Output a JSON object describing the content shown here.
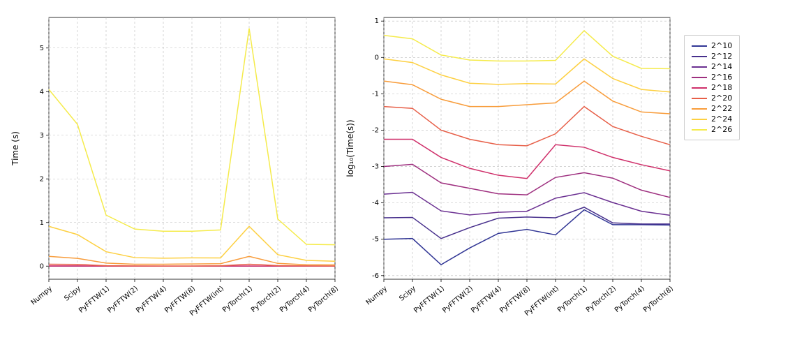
{
  "chart_data": [
    {
      "type": "line",
      "title": "",
      "xlabel": "",
      "ylabel": "Time (s)",
      "ylim": [
        -0.3,
        5.7
      ],
      "yticks": [
        0,
        1,
        2,
        3,
        4,
        5
      ],
      "categories": [
        "Numpy",
        "Scipy",
        "PyFFTW(1)",
        "PyFFTW(2)",
        "PyFFTW(4)",
        "PyFFTW(8)",
        "PyFFTW(int)",
        "PyTorch(1)",
        "PyTorch(2)",
        "PyTorch(4)",
        "PyTorch(8)"
      ],
      "series": [
        {
          "name": "2^10",
          "color": "#313695",
          "values": [
            1e-05,
            1.05e-05,
            2e-06,
            5.75e-06,
            1.46e-05,
            1.88e-05,
            1.31e-05,
            6.46e-05,
            2.51e-05,
            2.51e-05,
            2.46e-05
          ]
        },
        {
          "name": "2^12",
          "color": "#472f8c",
          "values": [
            3.89e-05,
            3.98e-05,
            1.05e-05,
            2.09e-05,
            3.8e-05,
            4.07e-05,
            3.89e-05,
            7.59e-05,
            2.82e-05,
            2.63e-05,
            2.63e-05
          ]
        },
        {
          "name": "2^14",
          "color": "#6a2f91",
          "values": [
            0.000174,
            0.000195,
            6.03e-05,
            4.68e-05,
            5.5e-05,
            5.89e-05,
            0.000135,
            0.000191,
            0.000102,
            5.89e-05,
            4.57e-05
          ]
        },
        {
          "name": "2^16",
          "color": "#9e2f7f",
          "values": [
            0.001,
            0.00115,
            0.000355,
            0.000251,
            0.000178,
            0.000166,
            0.000501,
            0.000676,
            0.000479,
            0.000224,
            0.000141
          ]
        },
        {
          "name": "2^18",
          "color": "#cf2f6a",
          "values": [
            0.00562,
            0.00562,
            0.00178,
            0.000891,
            0.000575,
            0.000468,
            0.00398,
            0.00339,
            0.00178,
            0.00112,
            0.000759
          ]
        },
        {
          "name": "2^20",
          "color": "#e75f48",
          "values": [
            0.0447,
            0.0398,
            0.01,
            0.00562,
            0.00398,
            0.00372,
            0.00794,
            0.0447,
            0.0126,
            0.00676,
            0.00398
          ]
        },
        {
          "name": "2^22",
          "color": "#f89c3a",
          "values": [
            0.224,
            0.178,
            0.0708,
            0.0447,
            0.0447,
            0.0501,
            0.0562,
            0.224,
            0.0631,
            0.0316,
            0.0282
          ]
        },
        {
          "name": "2^24",
          "color": "#fdd041",
          "values": [
            0.912,
            0.724,
            0.331,
            0.195,
            0.182,
            0.19,
            0.188,
            0.912,
            0.263,
            0.132,
            0.112
          ]
        },
        {
          "name": "2^26",
          "color": "#f5eb4b",
          "values": [
            4.05,
            3.25,
            1.17,
            0.85,
            0.8,
            0.8,
            0.83,
            5.45,
            1.08,
            0.5,
            0.49
          ]
        }
      ]
    },
    {
      "type": "line",
      "title": "",
      "xlabel": "",
      "ylabel": "log₁₀(Time(s))",
      "ylim": [
        -6.1,
        1.1
      ],
      "yticks": [
        -6,
        -5,
        -4,
        -3,
        -2,
        -1,
        0,
        1
      ],
      "categories": [
        "Numpy",
        "Scipy",
        "PyFFTW(1)",
        "PyFFTW(2)",
        "PyFFTW(4)",
        "PyFFTW(8)",
        "PyFFTW(int)",
        "PyTorch(1)",
        "PyTorch(2)",
        "PyTorch(4)",
        "PyTorch(8)"
      ],
      "series": [
        {
          "name": "2^10",
          "color": "#313695",
          "values": [
            -5.0,
            -4.98,
            -5.7,
            -5.24,
            -4.84,
            -4.73,
            -4.88,
            -4.19,
            -4.6,
            -4.6,
            -4.61
          ]
        },
        {
          "name": "2^12",
          "color": "#472f8c",
          "values": [
            -4.41,
            -4.4,
            -4.98,
            -4.68,
            -4.42,
            -4.39,
            -4.41,
            -4.12,
            -4.55,
            -4.58,
            -4.58
          ]
        },
        {
          "name": "2^14",
          "color": "#6a2f91",
          "values": [
            -3.76,
            -3.71,
            -4.22,
            -4.33,
            -4.26,
            -4.23,
            -3.87,
            -3.72,
            -3.99,
            -4.23,
            -4.34
          ]
        },
        {
          "name": "2^16",
          "color": "#9e2f7f",
          "values": [
            -3.0,
            -2.94,
            -3.45,
            -3.6,
            -3.75,
            -3.78,
            -3.3,
            -3.17,
            -3.32,
            -3.65,
            -3.85
          ]
        },
        {
          "name": "2^18",
          "color": "#cf2f6a",
          "values": [
            -2.25,
            -2.25,
            -2.75,
            -3.05,
            -3.24,
            -3.33,
            -2.4,
            -2.47,
            -2.75,
            -2.95,
            -3.12
          ]
        },
        {
          "name": "2^20",
          "color": "#e75f48",
          "values": [
            -1.35,
            -1.4,
            -2.0,
            -2.25,
            -2.4,
            -2.43,
            -2.1,
            -1.35,
            -1.9,
            -2.17,
            -2.4
          ]
        },
        {
          "name": "2^22",
          "color": "#f89c3a",
          "values": [
            -0.65,
            -0.75,
            -1.15,
            -1.35,
            -1.35,
            -1.3,
            -1.25,
            -0.65,
            -1.2,
            -1.5,
            -1.55
          ]
        },
        {
          "name": "2^24",
          "color": "#fdd041",
          "values": [
            -0.04,
            -0.14,
            -0.48,
            -0.71,
            -0.74,
            -0.72,
            -0.73,
            -0.04,
            -0.58,
            -0.88,
            -0.95
          ]
        },
        {
          "name": "2^26",
          "color": "#f5eb4b",
          "values": [
            0.607,
            0.512,
            0.068,
            -0.071,
            -0.097,
            -0.097,
            -0.081,
            0.737,
            0.033,
            -0.301,
            -0.31
          ]
        }
      ]
    }
  ],
  "legend": {
    "entries": [
      "2^10",
      "2^12",
      "2^14",
      "2^16",
      "2^18",
      "2^20",
      "2^22",
      "2^24",
      "2^26"
    ]
  }
}
